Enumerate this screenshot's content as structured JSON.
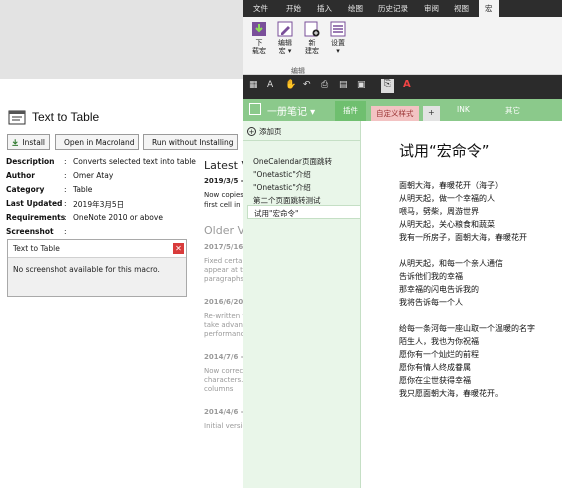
{
  "macro": {
    "title": "Text to Table",
    "buttons": {
      "install": "Install",
      "open": "Open in Macroland",
      "run": "Run without Installing"
    },
    "details": [
      {
        "key": "Description",
        "value": "Converts selected text into table"
      },
      {
        "key": "Author",
        "value": "Omer Atay"
      },
      {
        "key": "Category",
        "value": "Table"
      },
      {
        "key": "Last Updated",
        "value": "2019年3月5日"
      },
      {
        "key": "Requirements",
        "value": "OneNote 2010 or above"
      },
      {
        "key": "Screenshot",
        "value": ""
      }
    ],
    "colon": ":",
    "screenshot_title": "Text to Table",
    "screenshot_message": "No screenshot available for this macro.",
    "latest_heading": "Latest V",
    "latest_date": "2019/3/5 -",
    "latest_text": [
      "Now copies",
      "first cell in e"
    ],
    "older_heading": "Older V",
    "versions": [
      {
        "date": "2017/5/16",
        "lines": [
          "Fixed certai",
          "appear at th",
          "paragraphs."
        ]
      },
      {
        "date": "2016/6/20",
        "lines": [
          "Re-written w",
          "take advant",
          "performanc"
        ]
      },
      {
        "date": "2014/7/6 -",
        "lines": [
          "Now correc",
          "characters. C",
          "columns"
        ]
      },
      {
        "date": "2014/4/6 -",
        "lines": [
          "Initial versio"
        ]
      }
    ]
  },
  "onenote": {
    "menu": [
      "文件",
      "开始",
      "插入",
      "绘图",
      "历史记录",
      "审阅",
      "视图",
      "宏"
    ],
    "ribbon_buttons": [
      {
        "label": "下\n载宏"
      },
      {
        "label": "编辑\n宏 ▾"
      },
      {
        "label": "新\n建宏"
      },
      {
        "label": "设置\n▾"
      }
    ],
    "ribbon_group": "编辑",
    "notebook_name": "一册笔记 ▾",
    "tabs": [
      "插件",
      "自定义样式",
      "+"
    ],
    "tab_right": [
      "INK",
      "其它"
    ],
    "add_page": "添加页",
    "pages": [
      "OneCalendar页面跳转",
      "\"Onetastic\"介绍",
      "\"Onetastic\"介绍",
      "第二个页面跳转测试",
      "试用\"宏命令\""
    ],
    "page_title": "试用“宏命令”",
    "body": [
      "面朝大海，春暖花开（海子）",
      "从明天起，做一个幸福的人",
      "喂马，劈柴，周游世界",
      "从明天起，关心粮食和蔬菜",
      "我有一所房子，面朝大海，春暖花开",
      "",
      "从明天起，和每一个亲人通信",
      "告诉他们我的幸福",
      "那幸福的闪电告诉我的",
      "我将告诉每一个人",
      "",
      "给每一条河每一座山取一个温暖的名字",
      "陌生人，我也为你祝福",
      "愿你有一个灿烂的前程",
      "愿你有情人终成眷属",
      "愿你在尘世获得幸福",
      "我只愿面朝大海，春暖花开。"
    ]
  },
  "colors": {
    "accent_green": "#8bc98b",
    "menu_bg": "#2d2d2d",
    "active_tab": "#8bc98b",
    "close_red": "#d83b3b"
  },
  "icons": [
    "macro-icon",
    "install-icon",
    "macroland-icon",
    "run-icon",
    "close-icon",
    "download-macro-icon",
    "edit-macro-icon",
    "new-macro-icon",
    "settings-icon",
    "add-page-icon"
  ]
}
